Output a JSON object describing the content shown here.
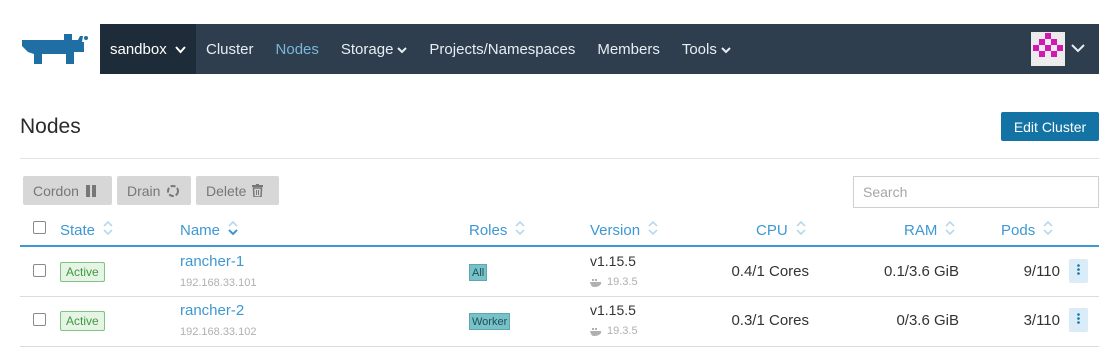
{
  "header": {
    "cluster": "sandbox",
    "nav": [
      {
        "label": "Cluster"
      },
      {
        "label": "Nodes"
      },
      {
        "label": "Storage"
      },
      {
        "label": "Projects/Namespaces"
      },
      {
        "label": "Members"
      },
      {
        "label": "Tools"
      }
    ]
  },
  "page": {
    "title": "Nodes",
    "edit_button": "Edit Cluster"
  },
  "bulk_actions": {
    "cordon": "Cordon",
    "drain": "Drain",
    "delete": "Delete"
  },
  "search": {
    "placeholder": "Search",
    "value": ""
  },
  "table": {
    "columns": {
      "state": "State",
      "name": "Name",
      "roles": "Roles",
      "version": "Version",
      "cpu": "CPU",
      "ram": "RAM",
      "pods": "Pods"
    },
    "rows": [
      {
        "state": "Active",
        "name": "rancher-1",
        "ip": "192.168.33.101",
        "role": "All",
        "version": "v1.15.5",
        "docker": "19.3.5",
        "cpu": "0.4/1 Cores",
        "ram": "0.1/3.6 GiB",
        "pods": "9/110"
      },
      {
        "state": "Active",
        "name": "rancher-2",
        "ip": "192.168.33.102",
        "role": "Worker",
        "version": "v1.15.5",
        "docker": "19.3.5",
        "cpu": "0.3/1 Cores",
        "ram": "0/3.6 GiB",
        "pods": "3/110"
      }
    ]
  },
  "colors": {
    "nav_bg": "#2e3e4e",
    "cluster_bg": "#1e2b38",
    "accent": "#3d98d3",
    "primary_button": "#1373a5",
    "logo": "#1f6fa5",
    "active_badge": "#3c9a3f"
  },
  "icons": [
    "rancher-logo",
    "chevron-down-icon",
    "pause-icon",
    "refresh-icon",
    "trash-icon",
    "sort-icon",
    "docker-icon",
    "kebab-menu-icon"
  ]
}
